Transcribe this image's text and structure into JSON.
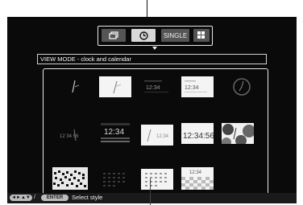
{
  "tabs": [
    {
      "icon": "slideshow-icon",
      "label": ""
    },
    {
      "icon": "clock-icon",
      "label": ""
    },
    {
      "icon": "",
      "label": "SINGLE"
    },
    {
      "icon": "index-grid-icon",
      "label": ""
    }
  ],
  "selected_tab": 1,
  "title": "VIEW MODE - clock and calendar",
  "thumbnails": [
    {
      "style": "analog-clock-dark"
    },
    {
      "style": "analog-clock-light"
    },
    {
      "style": "digital-clock-dark",
      "time": "12:34"
    },
    {
      "style": "digital-clock-light",
      "time": "12:34"
    },
    {
      "style": "round-clock-dark"
    },
    {
      "style": "analog-seconds-dark",
      "time": "12 34 56"
    },
    {
      "style": "big-digital-dark",
      "time": "12:34"
    },
    {
      "style": "analog-digital-light",
      "time": "12:34"
    },
    {
      "style": "digital-large-light",
      "time": "12:34:56"
    },
    {
      "style": "photo-clock-bubbles"
    },
    {
      "style": "calendar-photo-mosaic"
    },
    {
      "style": "calendar-dark"
    },
    {
      "style": "calendar-light"
    },
    {
      "style": "calendar-checker",
      "time": "12:34"
    }
  ],
  "footer": {
    "nav_keys": "◄►▲▼",
    "separator": "/",
    "enter_key": "ENTER",
    "label": "Select style"
  }
}
